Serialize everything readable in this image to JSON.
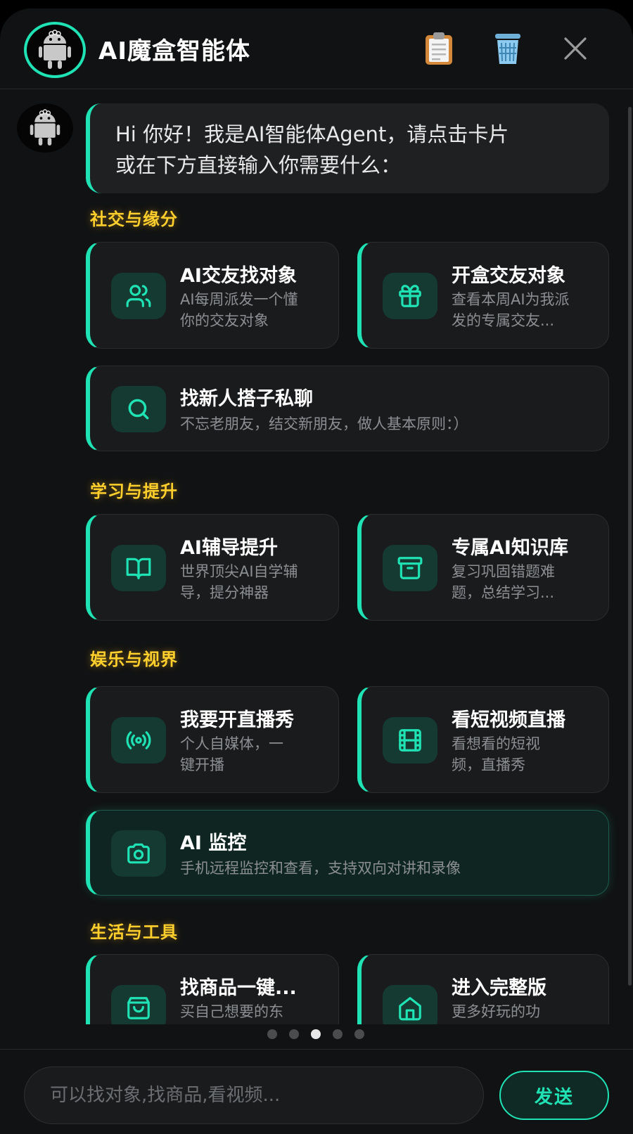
{
  "header": {
    "title": "AI魔盒智能体",
    "actions": [
      "clipboard-icon",
      "trash-icon",
      "close-icon"
    ]
  },
  "greeting": {
    "line1": "Hi 你好！我是AI智能体Agent，请点击卡片",
    "line2": "或在下方直接输入你需要什么："
  },
  "sections": [
    {
      "title": "社交与缘分",
      "cards": [
        {
          "title": "AI交友找对象",
          "desc1": "AI每周派发一个懂",
          "desc2": "你的交友对象",
          "icon": "people-icon"
        },
        {
          "title": "开盒交友对象",
          "desc1": "查看本周AI为我派",
          "desc2": "发的专属交友...",
          "icon": "gift-icon"
        },
        {
          "title": "找新人搭子私聊",
          "desc1": "不忘老朋友，结交新朋友，做人基本原则：）",
          "icon": "search-icon"
        }
      ]
    },
    {
      "title": "学习与提升",
      "cards": [
        {
          "title": "AI辅导提升",
          "desc1": "世界顶尖AI自学辅",
          "desc2": "导，提分神器",
          "icon": "book-icon"
        },
        {
          "title": "专属AI知识库",
          "desc1": "复习巩固错题难",
          "desc2": "题，总结学习...",
          "icon": "archive-icon"
        }
      ]
    },
    {
      "title": "娱乐与视界",
      "cards": [
        {
          "title": "我要开直播秀",
          "desc1": "个人自媒体，一",
          "desc2": "键开播",
          "icon": "broadcast-icon"
        },
        {
          "title": "看短视频直播",
          "desc1": "看想看的短视",
          "desc2": "频，直播秀",
          "icon": "film-icon"
        },
        {
          "title": "AI 监控",
          "desc1": "手机远程监控和查看，支持双向对讲和录像",
          "icon": "camera-icon"
        }
      ]
    },
    {
      "title": "生活与工具",
      "cards": [
        {
          "title": "找商品一键...",
          "desc1": "买自己想要的东",
          "icon": "shopping-bag-icon"
        },
        {
          "title": "进入完整版",
          "desc1": "更多好玩的功",
          "icon": "home-icon"
        }
      ]
    }
  ],
  "pager": {
    "count": 5,
    "active": 2
  },
  "composer": {
    "placeholder": "可以找对象,找商品,看视频...",
    "send_label": "发送"
  },
  "colors": {
    "accent": "#1fe3b4",
    "section": "#ffcf2c",
    "card": "#1a1b1d",
    "panel": "#111213"
  }
}
